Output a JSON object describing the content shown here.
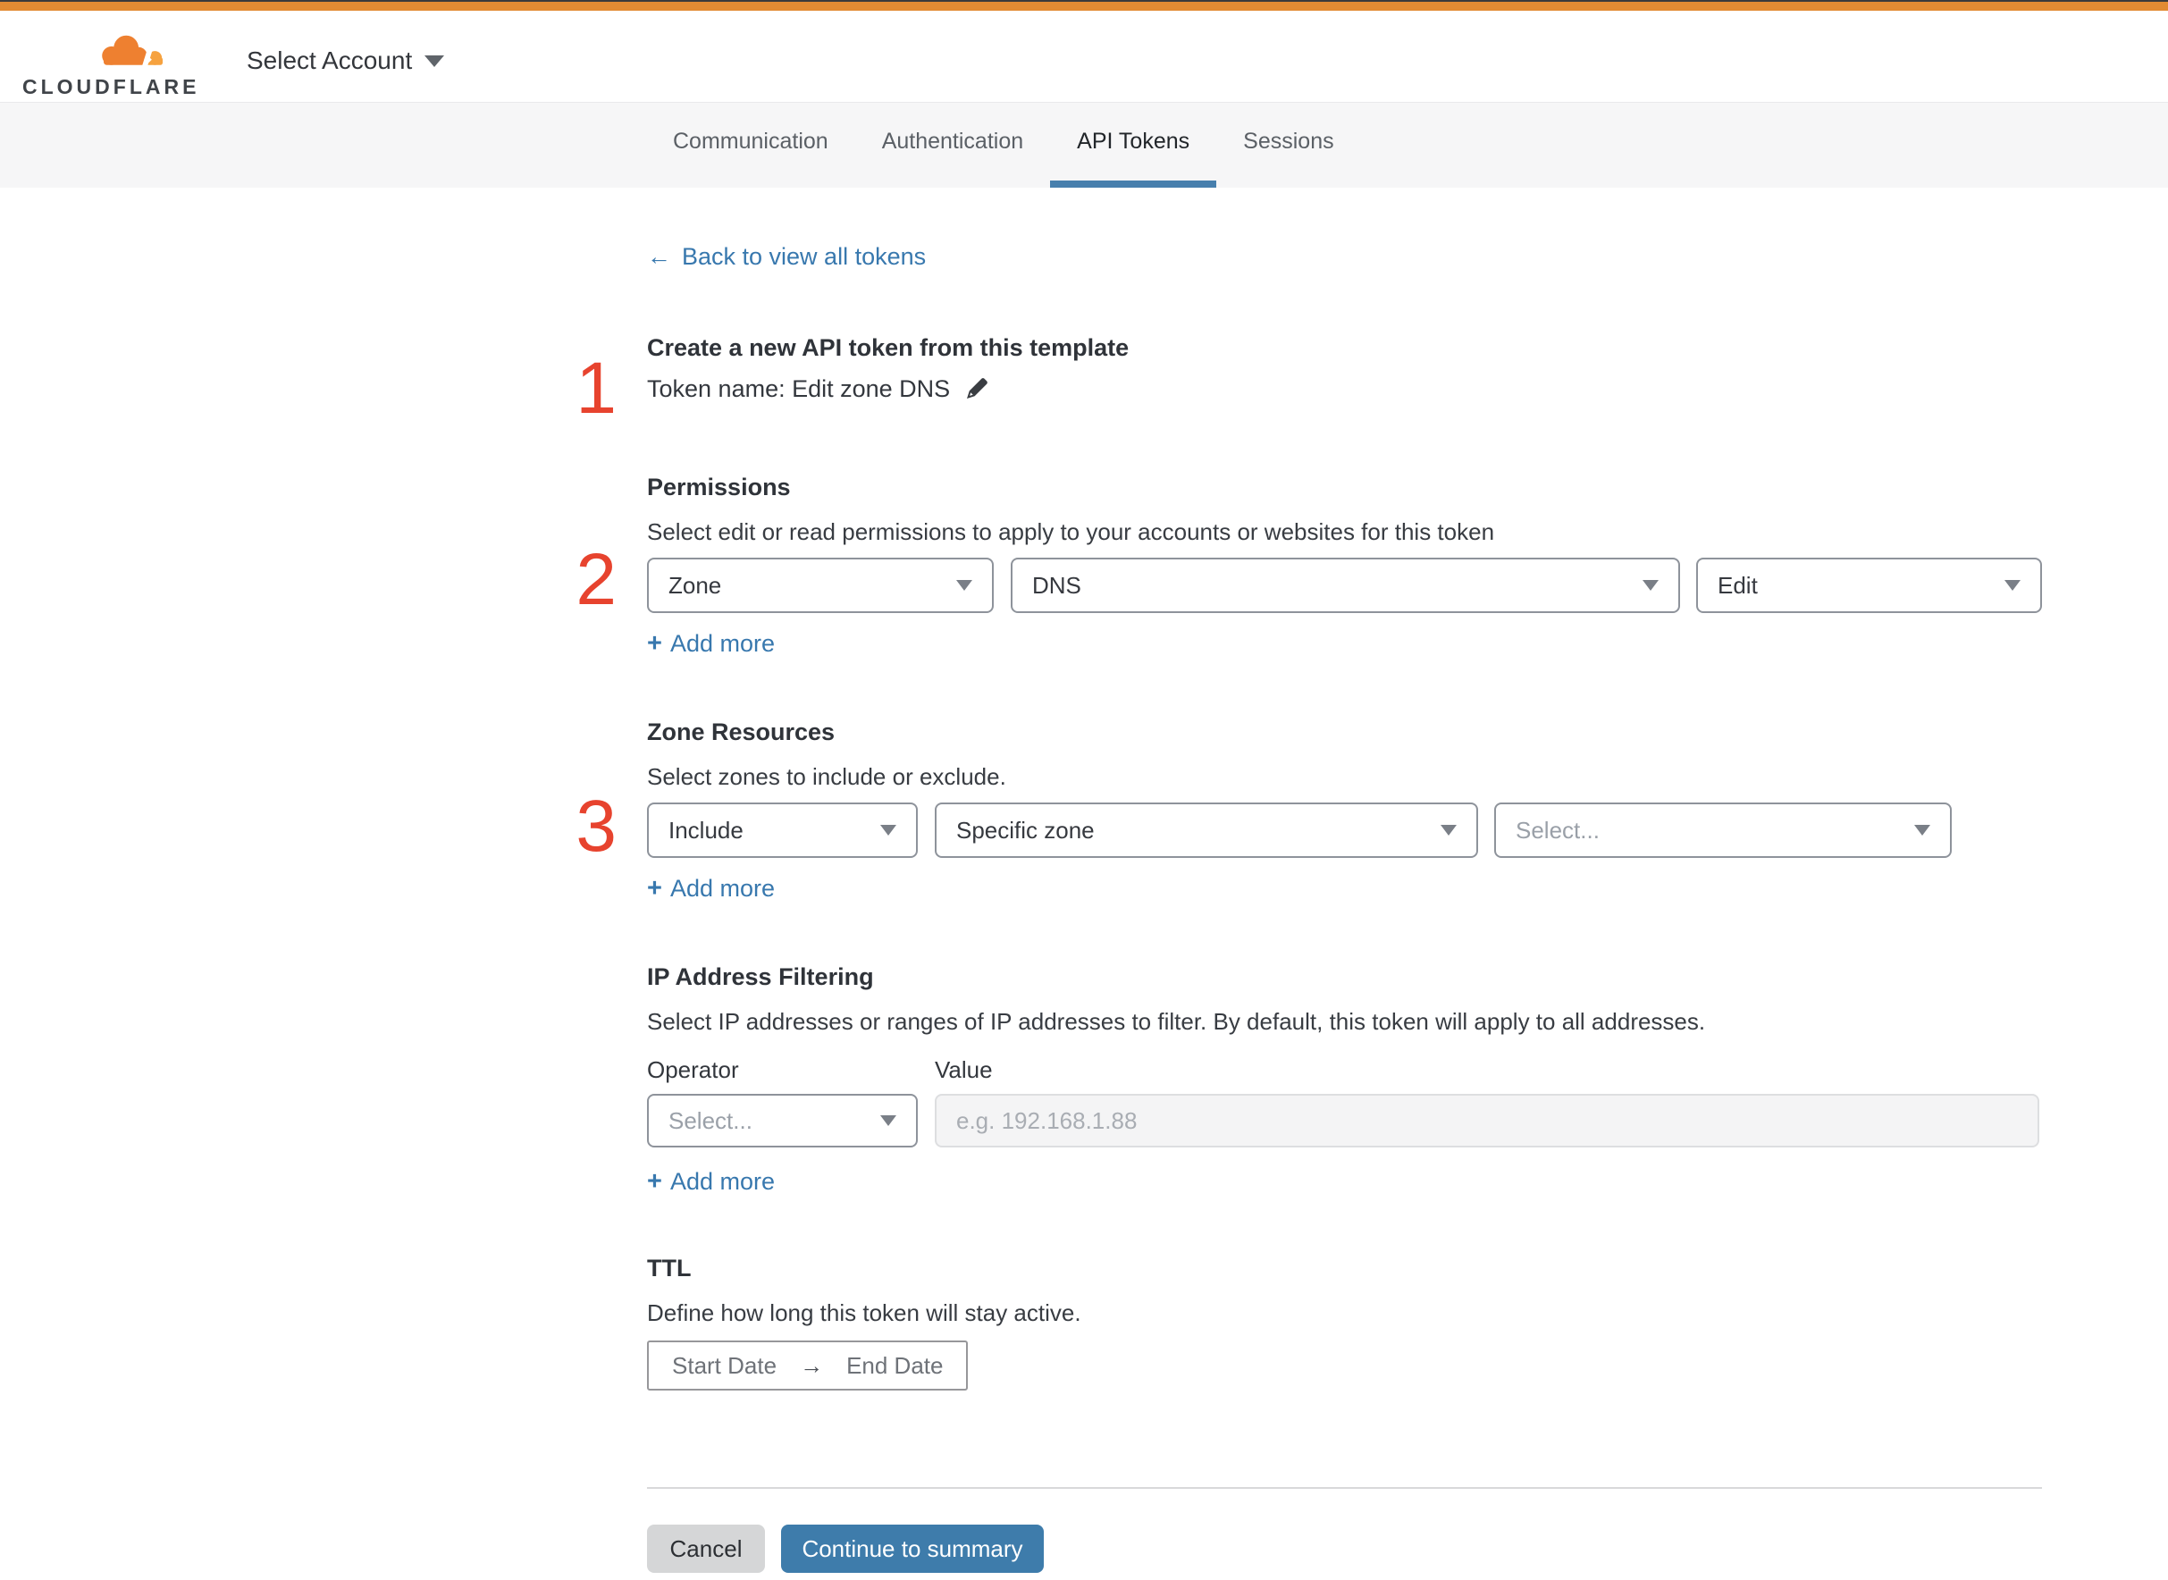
{
  "header": {
    "logo_text": "CLOUDFLARE",
    "account_selector": "Select Account"
  },
  "tabs": [
    {
      "label": "Communication",
      "active": false
    },
    {
      "label": "Authentication",
      "active": false
    },
    {
      "label": "API Tokens",
      "active": true
    },
    {
      "label": "Sessions",
      "active": false
    }
  ],
  "back_link": {
    "arrow": "←",
    "label": "Back to view all tokens"
  },
  "token_section": {
    "step": "1",
    "heading": "Create a new API token from this template",
    "name_line": "Token name: Edit zone DNS"
  },
  "permissions": {
    "step": "2",
    "heading": "Permissions",
    "description": "Select edit or read permissions to apply to your accounts or websites for this token",
    "scope": "Zone",
    "service": "DNS",
    "access": "Edit",
    "add_more": {
      "plus": "+",
      "label": "Add more"
    }
  },
  "zone_resources": {
    "step": "3",
    "heading": "Zone Resources",
    "description": "Select zones to include or exclude.",
    "operator": "Include",
    "scope": "Specific zone",
    "zone_placeholder": "Select...",
    "add_more": {
      "plus": "+",
      "label": "Add more"
    }
  },
  "ip_filtering": {
    "heading": "IP Address Filtering",
    "description": "Select IP addresses or ranges of IP addresses to filter. By default, this token will apply to all addresses.",
    "operator_label": "Operator",
    "value_label": "Value",
    "operator_placeholder": "Select...",
    "value_placeholder": "e.g. 192.168.1.88",
    "add_more": {
      "plus": "+",
      "label": "Add more"
    }
  },
  "ttl": {
    "heading": "TTL",
    "description": "Define how long this token will stay active.",
    "start_label": "Start Date",
    "arrow": "→",
    "end_label": "End Date"
  },
  "footer": {
    "cancel_label": "Cancel",
    "continue_label": "Continue to summary"
  },
  "colors": {
    "brand_orange": "#e28b33",
    "link_blue": "#3878ae",
    "button_blue": "#3e7cab",
    "step_red": "#e7432e",
    "tab_underline": "#477fad",
    "tabbar_bg": "#f6f6f7"
  }
}
